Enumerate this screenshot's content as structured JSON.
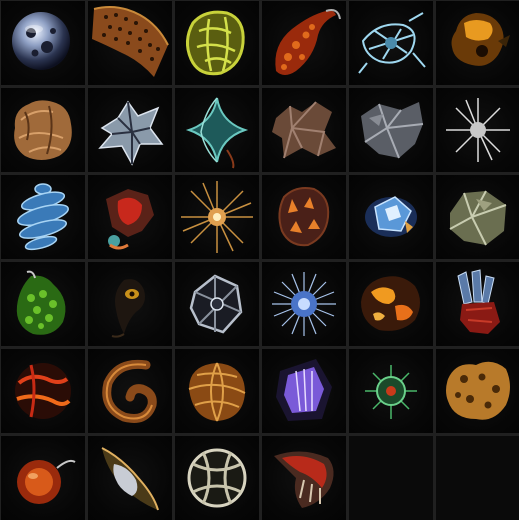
{
  "inventory": {
    "columns": 6,
    "rows": 6,
    "items": [
      {
        "icon": "glass-orb-icon"
      },
      {
        "icon": "spotted-hide-scroll-icon"
      },
      {
        "icon": "green-lattice-husk-icon"
      },
      {
        "icon": "molten-crest-icon"
      },
      {
        "icon": "crystal-web-icon"
      },
      {
        "icon": "amber-nugget-icon"
      },
      {
        "icon": "rock-bulb-icon"
      },
      {
        "icon": "silver-crystal-cluster-icon"
      },
      {
        "icon": "teal-star-tendril-icon"
      },
      {
        "icon": "bark-fragment-icon"
      },
      {
        "icon": "grey-stone-chunk-icon"
      },
      {
        "icon": "white-starburst-icon"
      },
      {
        "icon": "blue-spiral-drill-icon"
      },
      {
        "icon": "red-fleshy-fragment-icon"
      },
      {
        "icon": "amber-spike-urchin-icon"
      },
      {
        "icon": "ember-shell-icon"
      },
      {
        "icon": "blue-gem-core-icon"
      },
      {
        "icon": "pale-green-rock-icon"
      },
      {
        "icon": "green-scale-leaf-icon"
      },
      {
        "icon": "shadow-wisp-icon"
      },
      {
        "icon": "dark-cage-icon"
      },
      {
        "icon": "blue-urchin-spine-icon"
      },
      {
        "icon": "lava-rock-icon"
      },
      {
        "icon": "crystal-spire-cluster-icon"
      },
      {
        "icon": "red-lava-orb-icon"
      },
      {
        "icon": "coiled-horn-icon"
      },
      {
        "icon": "amber-spiral-shell-icon"
      },
      {
        "icon": "purple-energy-crystal-icon"
      },
      {
        "icon": "green-spore-pod-icon"
      },
      {
        "icon": "ochre-bone-cluster-icon"
      },
      {
        "icon": "amber-tail-orb-icon"
      },
      {
        "icon": "silver-shell-fin-icon"
      },
      {
        "icon": "bone-lattice-sphere-icon"
      },
      {
        "icon": "red-ribbed-jaw-icon"
      },
      {
        "icon": "empty-slot"
      },
      {
        "icon": "empty-slot"
      }
    ]
  }
}
